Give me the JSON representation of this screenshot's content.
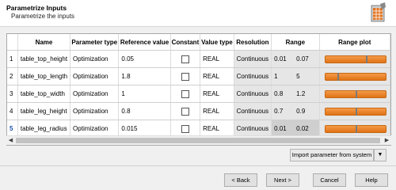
{
  "header": {
    "title": "Parametrize Inputs",
    "subtitle": "Parametrize the inputs",
    "icon": "parametrize-logo-icon"
  },
  "table": {
    "columns": [
      "Name",
      "Parameter type",
      "Reference value",
      "Constant",
      "Value type",
      "Resolution",
      "Range",
      "Range plot"
    ],
    "rows": [
      {
        "num": "1",
        "name": "table_top_height",
        "ptype": "Optimization",
        "ref": "0.05",
        "constant": false,
        "vtype": "REAL",
        "resolution": "Continuous",
        "lo": "0.01",
        "hi": "0.07",
        "marker": 0.67
      },
      {
        "num": "2",
        "name": "table_top_length",
        "ptype": "Optimization",
        "ref": "1.8",
        "constant": false,
        "vtype": "REAL",
        "resolution": "Continuous",
        "lo": "1",
        "hi": "5",
        "marker": 0.2
      },
      {
        "num": "3",
        "name": "table_top_width",
        "ptype": "Optimization",
        "ref": "1",
        "constant": false,
        "vtype": "REAL",
        "resolution": "Continuous",
        "lo": "0.8",
        "hi": "1.2",
        "marker": 0.5
      },
      {
        "num": "4",
        "name": "table_leg_height",
        "ptype": "Optimization",
        "ref": "0.8",
        "constant": false,
        "vtype": "REAL",
        "resolution": "Continuous",
        "lo": "0.7",
        "hi": "0.9",
        "marker": 0.5
      },
      {
        "num": "5",
        "name": "table_leg_radius",
        "ptype": "Optimization",
        "ref": "0.015",
        "constant": false,
        "vtype": "REAL",
        "resolution": "Continuous",
        "lo": "0.01",
        "hi": "0.02",
        "marker": 0.5,
        "selected": true
      }
    ]
  },
  "import": {
    "label": "Import parameter from system",
    "dropdown": "▼"
  },
  "buttons": {
    "back": "< Back",
    "next": "Next >",
    "cancel": "Cancel",
    "help": "Help"
  },
  "colors": {
    "bar": "#e8801e",
    "selected_row_num": "#1b4fa0"
  }
}
